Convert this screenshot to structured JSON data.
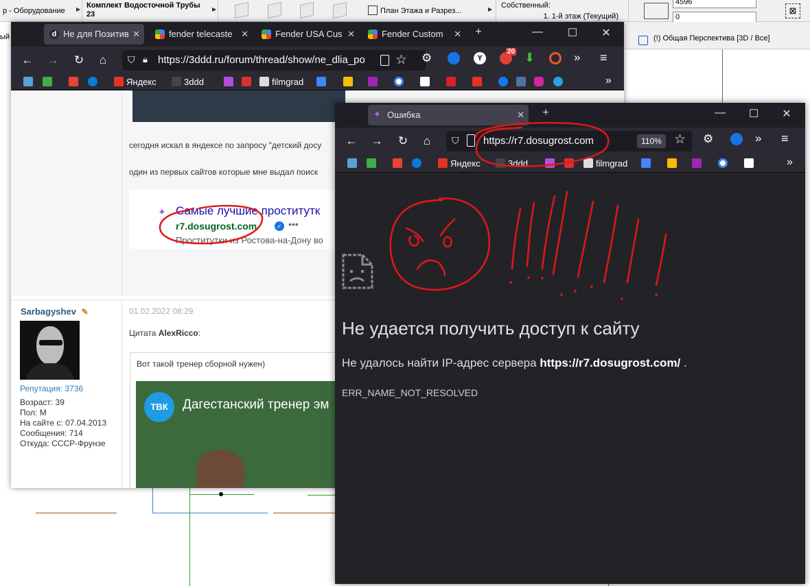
{
  "cad": {
    "cell1": "р - Оборудование",
    "cell2_line1": "Комплект Водосточной Трубы",
    "cell2_line2": "23",
    "cell3": "План Этажа и Разрез...",
    "cell4_label": "Собственный:",
    "cell4_value": "1. 1-й этаж (Текущий)",
    "input1": "4596",
    "input2": "0",
    "left_edge": "ый эт",
    "perspective": "(!) Общая Перспектива [3D / Все]"
  },
  "back_browser": {
    "tabs": [
      {
        "label": "Не для Позитив"
      },
      {
        "label": "fender telecaste"
      },
      {
        "label": "Fender USA Cus"
      },
      {
        "label": "Fender Custom"
      }
    ],
    "new_tab": "+",
    "url": "https://3ddd.ru/forum/thread/show/ne_dlia_po",
    "badge": "20",
    "bookmarks": [
      {
        "label": "Яндекс"
      },
      {
        "label": "3ddd"
      },
      {
        "label": "filmgrad"
      }
    ],
    "forum": {
      "post_line1": "сегодня искал в яндексе по запросу \"детский досу",
      "post_line2": "один из первых сайтов которые мне выдал поиск",
      "serp_title": "Самые лучшие проститутк",
      "serp_url": "r7.dosugrost.com",
      "serp_desc": "Проститутки из Ростова-на-Дону во",
      "user": {
        "name": "Sarbagyshev",
        "reputation": "Репутация: 3736",
        "age": "Возраст: 39",
        "gender": "Пол: М",
        "since": "На сайте с: 07.04.2013",
        "posts": "Сообщения: 714",
        "from": "Откуда: СССР-Фрунзе"
      },
      "post_date": "01.02.2022 08:29",
      "quote_prefix": "Цитата ",
      "quote_author": "AlexRicco",
      "quote_suffix": ":",
      "quote_text": "Вот такой тренер сборной нужен)",
      "video_logo": "ТВК",
      "video_title": "Дагестанский тренер эм"
    }
  },
  "front_browser": {
    "tab_title": "Ошибка",
    "new_tab": "+",
    "url": "https://r7.dosugrost.com",
    "zoom": "110%",
    "bookmarks": [
      {
        "label": "Яндекс"
      },
      {
        "label": "3ddd"
      },
      {
        "label": "filmgrad"
      }
    ],
    "error": {
      "title": "Не удается получить доступ к сайту",
      "desc_prefix": "Не удалось найти IP-адрес сервера ",
      "desc_url": "https://r7.dosugrost.com/",
      "desc_suffix": " .",
      "code": "ERR_NAME_NOT_RESOLVED"
    }
  },
  "colors": {
    "annotation_red": "#e01818",
    "firefox_dark": "#2b2a33",
    "page_dark": "#232327"
  }
}
